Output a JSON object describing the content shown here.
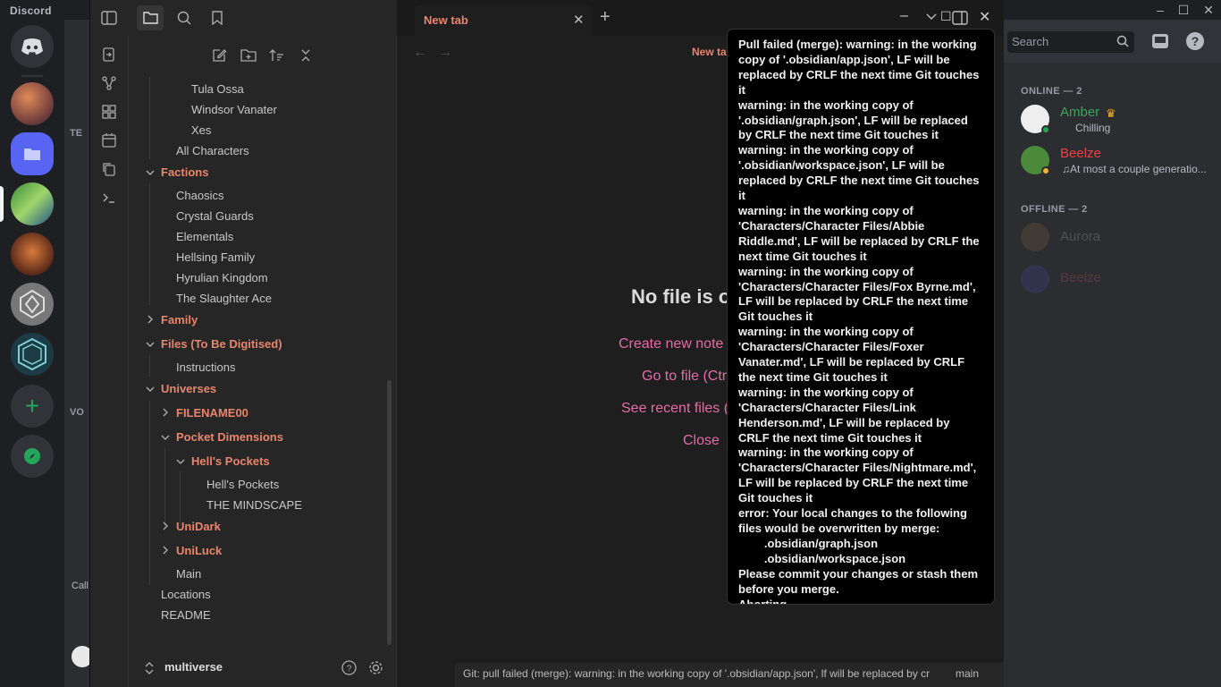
{
  "discord": {
    "brand": "Discord",
    "search_placeholder": "Search",
    "online_header": "ONLINE — 2",
    "offline_header": "OFFLINE — 2",
    "members_online": [
      {
        "name": "Amber",
        "status": "Chilling",
        "name_color": "#3ba55c"
      },
      {
        "name": "Beelze",
        "status": "At most a couple generatio...",
        "name_color": "#f23f42"
      }
    ],
    "members_offline": [
      {
        "name": "Aurora"
      },
      {
        "name": "Beelze"
      }
    ],
    "channel_sections": [
      "TE",
      "VO"
    ],
    "call_label": "Call"
  },
  "obsidian": {
    "tab_title": "New tab",
    "main_title": "New tab",
    "empty_state": {
      "title": "No file is open",
      "actions": [
        "Create new note (Ctrl + N)",
        "Go to file (Ctrl + O)",
        "See recent files (Ctrl + E)",
        "Close"
      ]
    },
    "file_tree": {
      "items": [
        {
          "label": "Tula Ossa"
        },
        {
          "label": "Windsor Vanater"
        },
        {
          "label": "Xes"
        },
        {
          "label": "All Characters"
        },
        {
          "label": "Factions"
        },
        {
          "label": "Chaosics"
        },
        {
          "label": "Crystal Guards"
        },
        {
          "label": "Elementals"
        },
        {
          "label": "Hellsing Family"
        },
        {
          "label": "Hyrulian Kingdom"
        },
        {
          "label": "The Slaughter Ace"
        },
        {
          "label": "Family"
        },
        {
          "label": "Files (To Be Digitised)"
        },
        {
          "label": "Instructions"
        },
        {
          "label": "Universes"
        },
        {
          "label": "FILENAME00"
        },
        {
          "label": "Pocket Dimensions"
        },
        {
          "label": "Hell's Pockets"
        },
        {
          "label": "Hell's Pockets"
        },
        {
          "label": "THE MINDSCAPE"
        },
        {
          "label": "UniDark"
        },
        {
          "label": "UniLuck"
        },
        {
          "label": "Main"
        },
        {
          "label": "Locations"
        },
        {
          "label": "README"
        }
      ]
    },
    "vault_name": "multiverse",
    "status_bar": {
      "git_message": "Git: pull failed (merge): warning: in the working copy of '.obsidian/app.json', lf will be replaced by cr",
      "branch": "main"
    },
    "notice": {
      "text": "Pull failed (merge): warning: in the working copy of '.obsidian/app.json', LF will be replaced by CRLF the next time Git touches it\nwarning: in the working copy of '.obsidian/graph.json', LF will be replaced by CRLF the next time Git touches it\nwarning: in the working copy of '.obsidian/workspace.json', LF will be replaced by CRLF the next time Git touches it\nwarning: in the working copy of 'Characters/Character Files/Abbie Riddle.md', LF will be replaced by CRLF the next time Git touches it\nwarning: in the working copy of 'Characters/Character Files/Fox Byrne.md', LF will be replaced by CRLF the next time Git touches it\nwarning: in the working copy of 'Characters/Character Files/Foxer Vanater.md', LF will be replaced by CRLF the next time Git touches it\nwarning: in the working copy of 'Characters/Character Files/Link Henderson.md', LF will be replaced by CRLF the next time Git touches it\nwarning: in the working copy of 'Characters/Character Files/Nightmare.md', LF will be replaced by CRLF the next time Git touches it\nerror: Your local changes to the following files would be overwritten by merge:\n        .obsidian/graph.json\n        .obsidian/workspace.json\nPlease commit your changes or stash them before you merge.\nAborting\nMerge with strategy ort failed."
    }
  }
}
